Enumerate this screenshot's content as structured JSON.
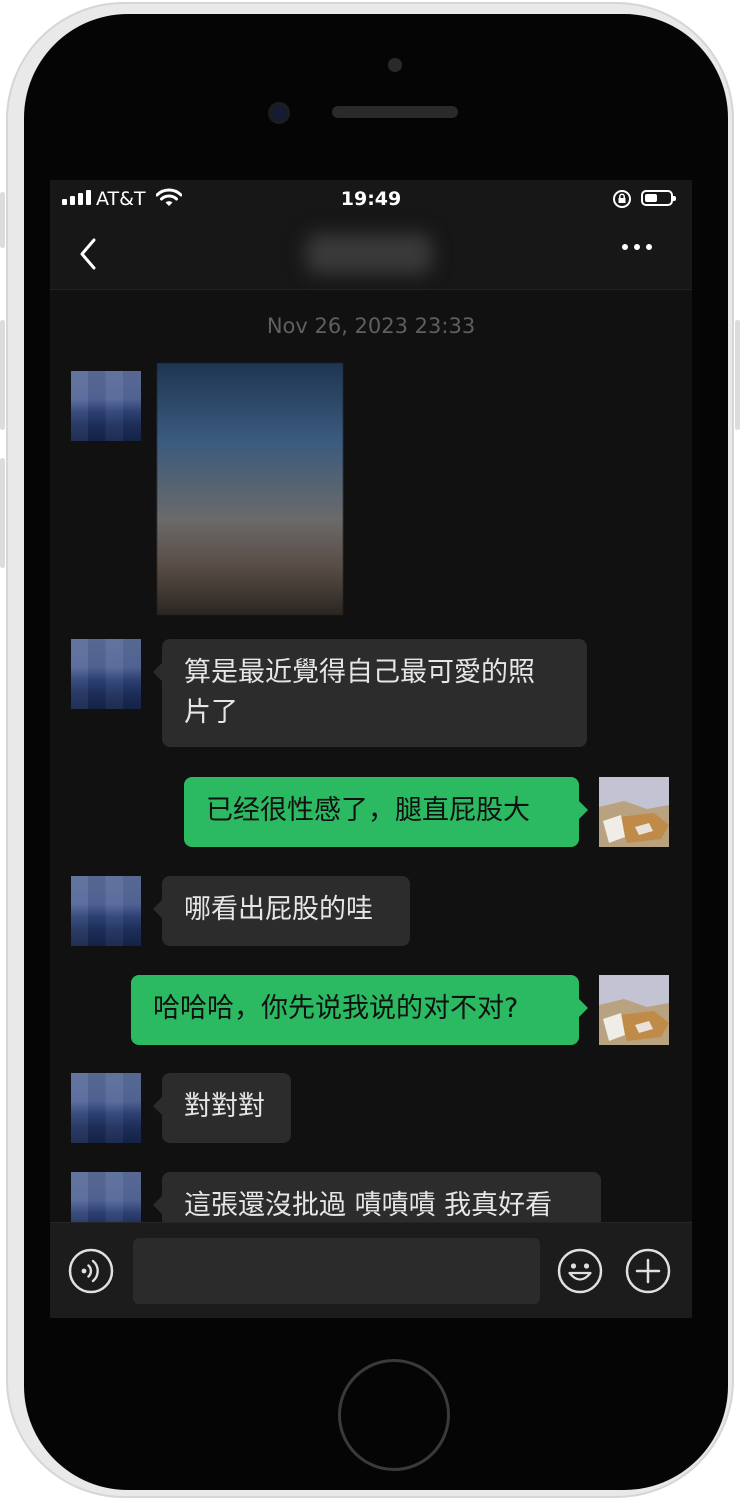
{
  "status_bar": {
    "carrier": "AT&T",
    "time": "19:49"
  },
  "nav": {
    "title": "",
    "back_icon": "chevron-left-icon",
    "more_icon": "more-dots-icon"
  },
  "chat": {
    "timestamp": "Nov 26, 2023 23:33",
    "messages": [
      {
        "side": "left",
        "type": "image"
      },
      {
        "side": "left",
        "type": "text",
        "text": "算是最近覺得自己最可愛的照\n片了"
      },
      {
        "side": "right",
        "type": "text",
        "text": "已经很性感了，腿直屁股大"
      },
      {
        "side": "left",
        "type": "text",
        "text": "哪看出屁股的哇"
      },
      {
        "side": "right",
        "type": "text",
        "text": "哈哈哈，你先说我说的对不对?"
      },
      {
        "side": "left",
        "type": "text",
        "text": "對對對"
      },
      {
        "side": "left",
        "type": "text",
        "text": "這張還沒批過 嘖嘖嘖 我真好看"
      }
    ]
  },
  "input_bar": {
    "placeholder": "",
    "voice_icon": "voice-icon",
    "emoji_icon": "emoji-icon",
    "plus_icon": "plus-icon"
  },
  "colors": {
    "screen_bg": "#111111",
    "bubble_received": "#2c2c2c",
    "bubble_sent": "#2bba62",
    "timestamp": "#5f5f5f"
  }
}
